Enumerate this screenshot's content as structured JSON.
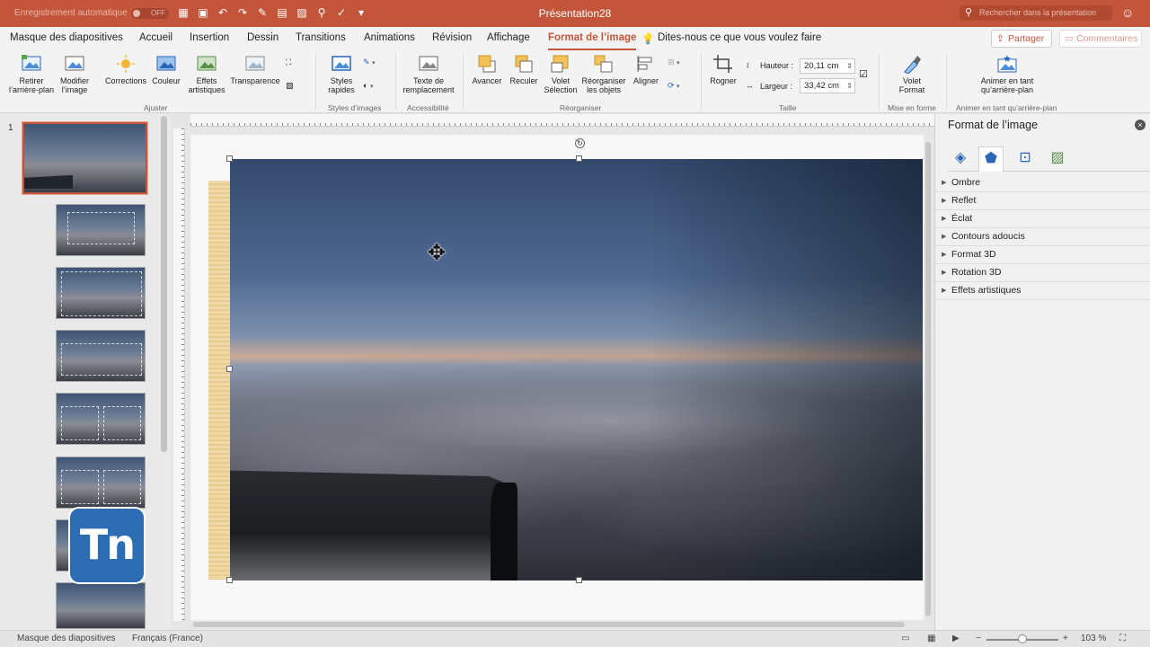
{
  "titlebar": {
    "autosave_label": "Enregistrement automatique",
    "autosave_state": "OFF",
    "document_title": "Présentation28",
    "search_placeholder": "Rechercher dans la présentation"
  },
  "tabs": [
    {
      "label": "Masque des diapositives"
    },
    {
      "label": "Accueil"
    },
    {
      "label": "Insertion"
    },
    {
      "label": "Dessin"
    },
    {
      "label": "Transitions"
    },
    {
      "label": "Animations"
    },
    {
      "label": "Révision"
    },
    {
      "label": "Affichage"
    },
    {
      "label": "Format de l’image",
      "active": true
    }
  ],
  "tell_me": "Dites-nous ce que vous voulez faire",
  "share_label": "Partager",
  "comments_label": "Commentaires",
  "ribbon": {
    "remove_bg": "Retirer l’arrière-plan",
    "modify_image": "Modifier l’image",
    "corrections": "Corrections",
    "color": "Couleur",
    "artistic_effects": "Effets artistiques",
    "transparency": "Transparence",
    "quick_styles": "Styles rapides",
    "alt_text": "Texte de remplacement",
    "bring_forward": "Avancer",
    "send_backward": "Reculer",
    "selection_pane": "Volet Sélection",
    "reorder_objects": "Réorganiser les objets",
    "align": "Aligner",
    "crop": "Rogner",
    "height_label": "Hauteur :",
    "height_value": "20,11 cm",
    "width_label": "Largeur :",
    "width_value": "33,42 cm",
    "format_pane": "Volet Format",
    "animate_bg": "Animer en tant qu’arrière-plan",
    "groups": {
      "adjust": "Ajuster",
      "image_styles": "Styles d’images",
      "accessibility": "Accessibilité",
      "arrange": "Réorganiser",
      "size": "Taille",
      "format": "Mise en forme",
      "animate": "Animer en tant qu’arrière-plan"
    }
  },
  "thumbnails": {
    "first_number": "1"
  },
  "logo_text": "Tn",
  "format_pane": {
    "title": "Format de l’image",
    "sections": [
      "Ombre",
      "Reflet",
      "Éclat",
      "Contours adoucis",
      "Format 3D",
      "Rotation 3D",
      "Effets artistiques"
    ]
  },
  "statusbar": {
    "view": "Masque des diapositives",
    "language": "Français (France)",
    "zoom": "103 %"
  },
  "colors": {
    "accent": "#c3553a",
    "pane_icon": "#2b66b6"
  }
}
